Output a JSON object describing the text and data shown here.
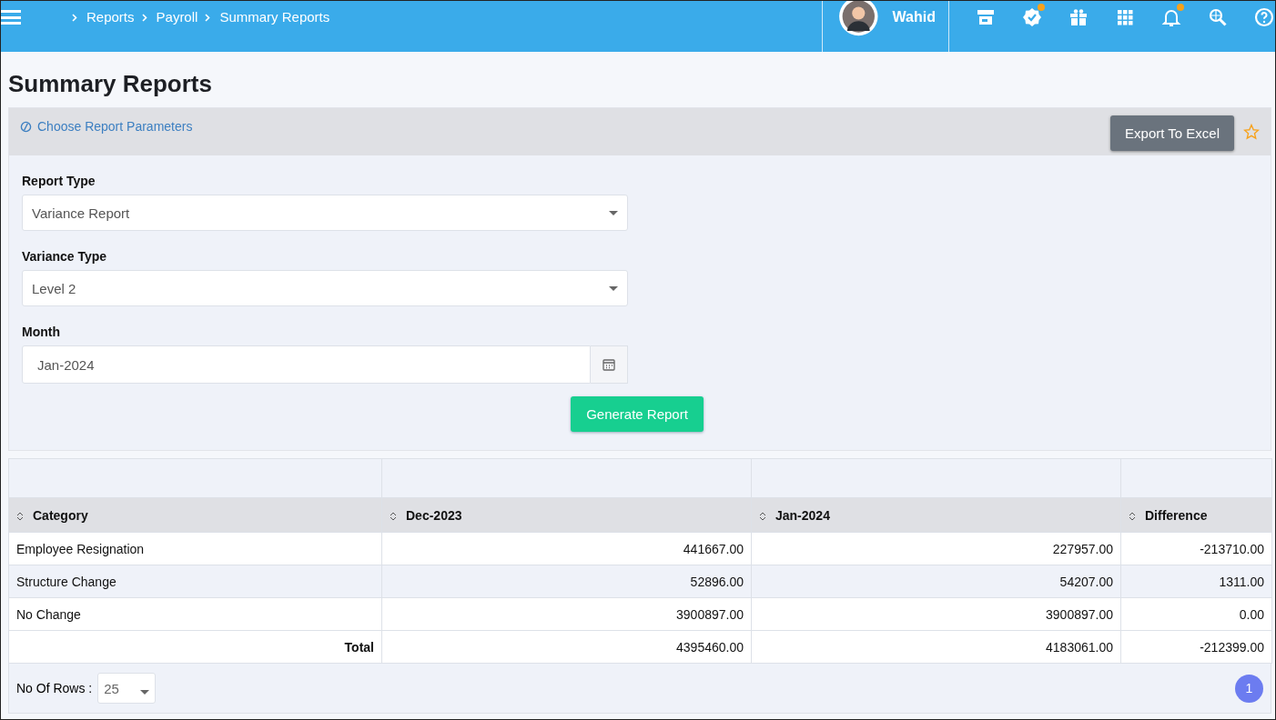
{
  "header": {
    "breadcrumb": [
      "Reports",
      "Payroll",
      "Summary Reports"
    ],
    "user_name": "Wahid",
    "tools": [
      {
        "kind": "store",
        "dot": false
      },
      {
        "kind": "verified",
        "dot": true
      },
      {
        "kind": "gift",
        "dot": false
      },
      {
        "kind": "apps",
        "dot": false
      },
      {
        "kind": "bell",
        "dot": true
      },
      {
        "kind": "globe-search",
        "dot": false
      },
      {
        "kind": "help",
        "dot": false
      }
    ]
  },
  "page_title": "Summary Reports",
  "parameters": {
    "title": "Choose Report Parameters",
    "export_button": "Export To Excel",
    "favorite": false,
    "fields": [
      {
        "kind": "select",
        "label": "Report Type",
        "value": "Variance Report"
      },
      {
        "kind": "select",
        "label": "Variance Type",
        "value": "Level 2"
      },
      {
        "kind": "date",
        "label": "Month",
        "value": "Jan-2024"
      }
    ],
    "generate_button": "Generate Report"
  },
  "table": {
    "columns": [
      "Category",
      "Dec-2023",
      "Jan-2024",
      "Difference"
    ],
    "rows": [
      [
        "Employee Resignation",
        "441667.00",
        "227957.00",
        "-213710.00"
      ],
      [
        "Structure Change",
        "52896.00",
        "54207.00",
        "1311.00"
      ],
      [
        "No Change",
        "3900897.00",
        "3900897.00",
        "0.00"
      ]
    ],
    "total": [
      "Total",
      "4395460.00",
      "4183061.00",
      "-212399.00"
    ]
  },
  "footer": {
    "rows_label": "No Of Rows :",
    "rows_value": "25",
    "pages": [
      {
        "label": "1",
        "selected": true
      }
    ]
  }
}
